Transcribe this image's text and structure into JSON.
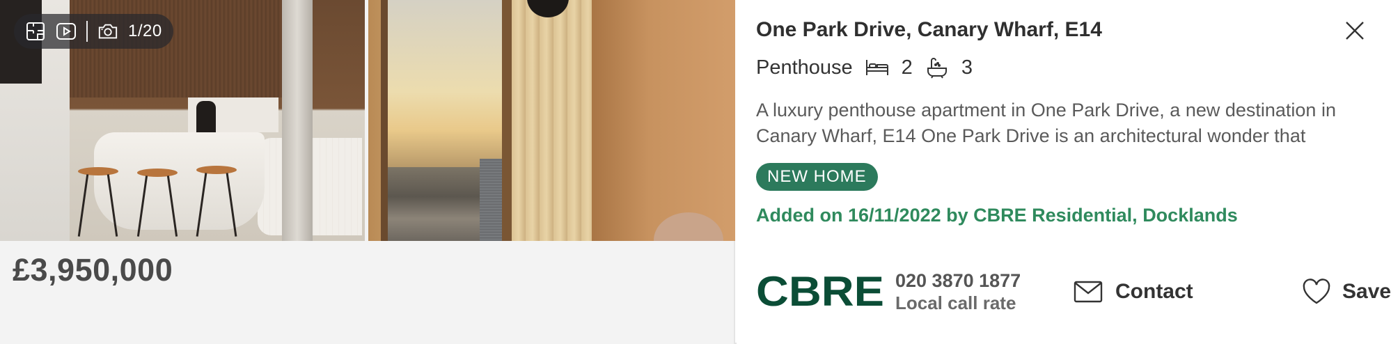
{
  "gallery": {
    "count_label": "1/20",
    "icons": [
      "floorplan-icon",
      "video-play-icon",
      "camera-icon"
    ]
  },
  "listing": {
    "price": "£3,950,000",
    "title": "One Park Drive, Canary Wharf, E14",
    "property_type": "Penthouse",
    "bedrooms": "2",
    "bathrooms": "3",
    "description": "A luxury penthouse apartment in One Park Drive, a new destination in Canary Wharf, E14 One Park Drive is an architectural wonder that",
    "badge": "NEW HOME",
    "added": "Added on 16/11/2022 by CBRE Residential, Docklands"
  },
  "agent": {
    "logo_text": "CBRE",
    "phone": "020 3870 1877",
    "call_rate": "Local call rate"
  },
  "actions": {
    "contact_label": "Contact",
    "save_label": "Save"
  },
  "colors": {
    "badge_bg": "#2c7a5c",
    "added_text": "#2f8a5d",
    "cbre_logo": "#0b4d36",
    "price_text": "#4a4a4a"
  }
}
